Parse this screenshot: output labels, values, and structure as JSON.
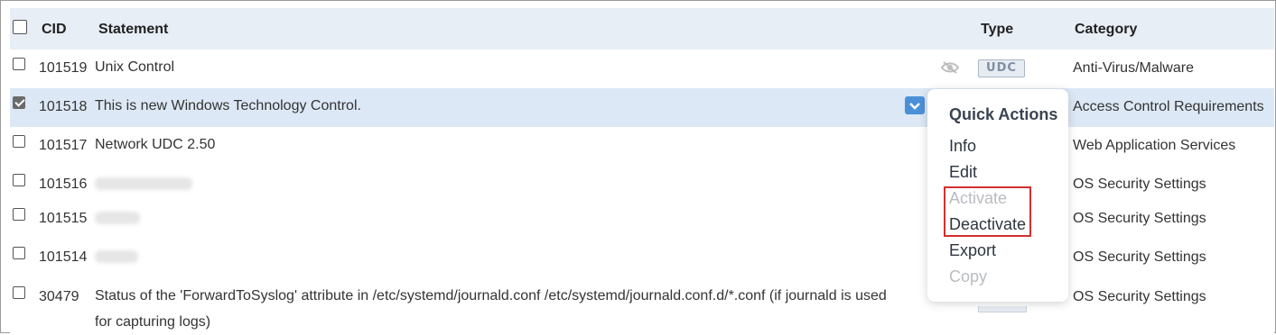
{
  "header": {
    "cid": "CID",
    "statement": "Statement",
    "type": "Type",
    "category": "Category"
  },
  "rows": [
    {
      "cid": "101519",
      "statement": "Unix Control",
      "category": "Anti-Virus/Malware",
      "type_badge": "UDC",
      "checked": false
    },
    {
      "cid": "101518",
      "statement": "This is new Windows Technology Control.",
      "category": "Access Control Requirements",
      "checked": true
    },
    {
      "cid": "101517",
      "statement": "Network UDC 2.50",
      "category": "Web Application Services",
      "checked": false
    },
    {
      "cid": "101516",
      "category": "OS Security Settings",
      "checked": false
    },
    {
      "cid": "101515",
      "category": "OS Security Settings",
      "checked": false
    },
    {
      "cid": "101514",
      "category": "OS Security Settings",
      "checked": false
    },
    {
      "cid": "30479",
      "statement_line1": "Status of the 'ForwardToSyslog' attribute in /etc/systemd/journald.conf /etc/systemd/journald.conf.d/*.conf (if journald is used",
      "statement_line2": "for capturing logs)",
      "category": "OS Security Settings",
      "checked": false
    }
  ],
  "quick_actions": {
    "title": "Quick Actions",
    "items": [
      {
        "label": "Info",
        "enabled": true
      },
      {
        "label": "Edit",
        "enabled": true
      },
      {
        "label": "Activate",
        "enabled": false
      },
      {
        "label": "Deactivate",
        "enabled": true
      },
      {
        "label": "Export",
        "enabled": true
      },
      {
        "label": "Copy",
        "enabled": false
      }
    ]
  },
  "icons": {
    "hidden": "eye-slash-icon",
    "dropdown": "chevron-down-icon"
  },
  "colors": {
    "header_bg": "#e8eef6",
    "selected_row_bg": "#dce8f5",
    "accent": "#4a90d9",
    "highlight": "#d32f2f"
  }
}
